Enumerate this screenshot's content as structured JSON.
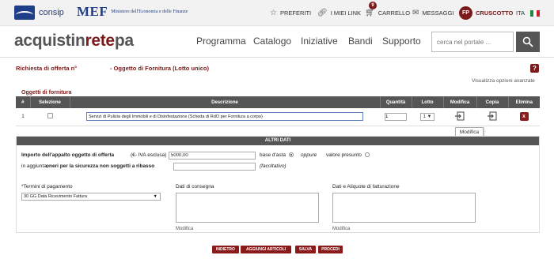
{
  "topbar": {
    "consip": "consip",
    "mef": "MEF",
    "mef_sub": "Ministero dell'Economia e delle Finanze",
    "preferiti": "PREFERITI",
    "link": "I MIEI LINK",
    "cart_count": "9",
    "carrello": "CARRELLO",
    "messaggi": "MESSAGGI",
    "avatar_initials": "FP",
    "cruscotto": "CRUSCOTTO",
    "lang": "ITA",
    "flag_colors": [
      "#1b8a3a",
      "#ffffff",
      "#c8202b"
    ]
  },
  "header": {
    "brand_a": "acquistin",
    "brand_b": "rete",
    "brand_c": "pa",
    "nav": [
      "Programma",
      "Catalogo",
      "Iniziative",
      "Bandi",
      "Supporto"
    ],
    "search_placeholder": "cerca nel portale ..."
  },
  "page": {
    "title": "Richiesta di offerta n°",
    "subtitle": "- Oggetto di Fornitura (Lotto unico)",
    "help": "?",
    "advanced": "Visualizza opzioni avanzate",
    "section": "Oggetti di fornitura"
  },
  "table": {
    "headers": [
      "#",
      "Selezione",
      "Descrizione",
      "Quantità",
      "Lotto",
      "Modifica",
      "Copia",
      "Elimina"
    ],
    "rows": [
      {
        "num": "1",
        "descrizione": "Servizi di Pulizia degli Immobili e di Disinfestazione (Scheda di RdO per Fornitura a corpo)",
        "quantita": "1",
        "lotto": "1 ▼",
        "elimina": "x"
      }
    ],
    "tooltip": "Modifica"
  },
  "altri": {
    "title": "ALTRI DATI",
    "importo_label": "Importo dell'appalto oggetto di offerta",
    "importo_hint": "(€- IVA esclusa)",
    "importo_value": "5000,00",
    "base_asta": "base d'asta",
    "oppure": "oppure",
    "valore_presunto": "valore presunto",
    "aggiunta_prefix": "in aggiunta,",
    "aggiunta_label": "oneri per la sicurezza non soggetti a ribasso",
    "facoltativo": "(facoltativo)",
    "termini_label": "*Termini di pagamento",
    "termini_value": "30 GG Data Ricevimento Fattura",
    "consegna_label": "Dati di consegna",
    "fatturazione_label": "Dati e Aliquote di fatturazione",
    "modifica": "Modifica"
  },
  "buttons": [
    "INDIETRO",
    "AGGIUNGI ARTICOLI",
    "SALVA",
    "PROCEDI"
  ]
}
